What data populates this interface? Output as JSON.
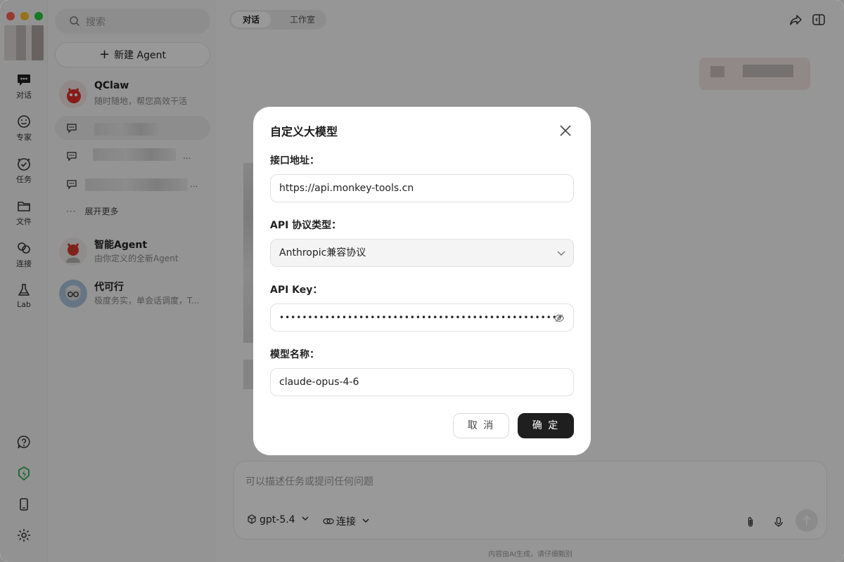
{
  "rail": {
    "items": [
      {
        "label": "对话",
        "icon": "chat-icon"
      },
      {
        "label": "专家",
        "icon": "expert-icon"
      },
      {
        "label": "任务",
        "icon": "task-icon"
      },
      {
        "label": "文件",
        "icon": "folder-icon"
      },
      {
        "label": "连接",
        "icon": "link-icon"
      },
      {
        "label": "Lab",
        "icon": "flask-icon"
      }
    ],
    "bottom_icons": [
      "help-icon",
      "brand-icon",
      "phone-icon",
      "settings-icon"
    ]
  },
  "sidebar": {
    "search_placeholder": "搜索",
    "new_agent_label": "新建 Agent",
    "agents_top": {
      "name": "QClaw",
      "desc": "随时随地，帮您高效干活"
    },
    "expand_label": "展开更多",
    "chat_more": "...",
    "agents": [
      {
        "name": "智能Agent",
        "desc": "由你定义的全新Agent"
      },
      {
        "name": "代可行",
        "desc": "极度务实，单会话调度，T..."
      }
    ]
  },
  "main": {
    "tabs": [
      {
        "label": "对话"
      },
      {
        "label": "工作室"
      }
    ],
    "composer": {
      "placeholder": "可以描述任务或提问任何问题",
      "model_label": "gpt-5.4",
      "connect_label": "连接"
    },
    "footnote": "内容由AI生成，请仔细甄别"
  },
  "modal": {
    "title": "自定义大模型",
    "endpoint_label": "接口地址：",
    "endpoint_value": "https://api.monkey-tools.cn",
    "protocol_label": "API 协议类型：",
    "protocol_value": "Anthropic兼容协议",
    "apikey_label": "API Key：",
    "apikey_mask": "••••••••••••••••••••••••••••••••••••••••••••••••••",
    "model_label": "模型名称：",
    "model_value": "claude-opus-4-6",
    "cancel_label": "取 消",
    "ok_label": "确 定"
  },
  "colors": {
    "primary_button": "#1f1f1f",
    "overlay": "rgba(0,0,0,0.40)",
    "brand": "#2fa84f"
  }
}
